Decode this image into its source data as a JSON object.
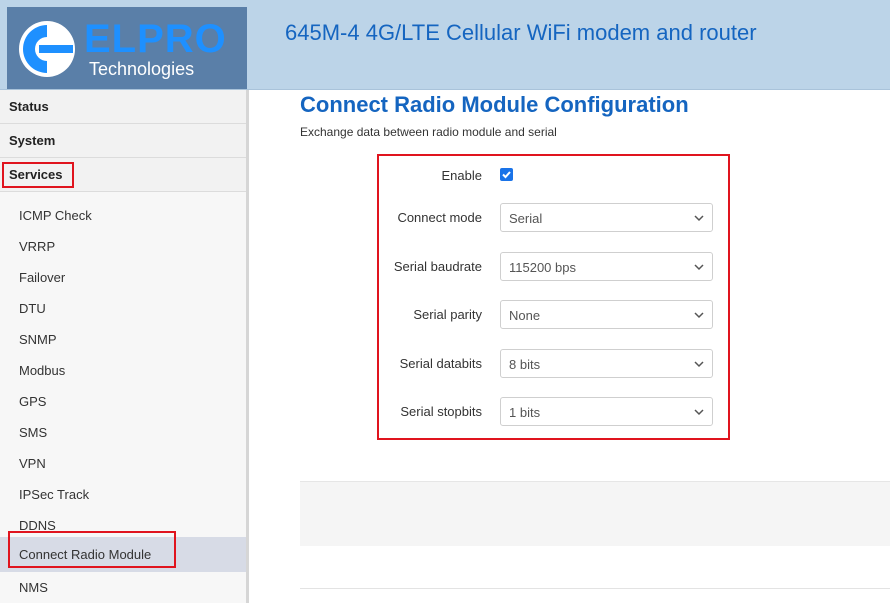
{
  "header": {
    "logo_text": "ELPRO",
    "logo_sub": "Technologies",
    "title": "645M-4 4G/LTE Cellular WiFi modem and router"
  },
  "sidebar": {
    "top_items": [
      {
        "label": "Status"
      },
      {
        "label": "System"
      },
      {
        "label": "Services"
      }
    ],
    "sub_items": [
      {
        "label": "ICMP Check"
      },
      {
        "label": "VRRP"
      },
      {
        "label": "Failover"
      },
      {
        "label": "DTU"
      },
      {
        "label": "SNMP"
      },
      {
        "label": "Modbus"
      },
      {
        "label": "GPS"
      },
      {
        "label": "SMS"
      },
      {
        "label": "VPN"
      },
      {
        "label": "IPSec Track"
      },
      {
        "label": "DDNS"
      },
      {
        "label": "Connect Radio Module"
      },
      {
        "label": "NMS"
      }
    ]
  },
  "main": {
    "title": "Connect Radio Module Configuration",
    "description": "Exchange data between radio module and serial",
    "form": {
      "enable_label": "Enable",
      "enable_checked": true,
      "fields": [
        {
          "label": "Connect mode",
          "value": "Serial"
        },
        {
          "label": "Serial baudrate",
          "value": "115200 bps"
        },
        {
          "label": "Serial parity",
          "value": "None"
        },
        {
          "label": "Serial databits",
          "value": "8 bits"
        },
        {
          "label": "Serial stopbits",
          "value": "1 bits"
        }
      ]
    }
  },
  "colors": {
    "header_bg": "#bcd4e8",
    "title_blue": "#1565c0",
    "highlight_red": "#e0141e",
    "checkbox_blue": "#1a73e8"
  }
}
